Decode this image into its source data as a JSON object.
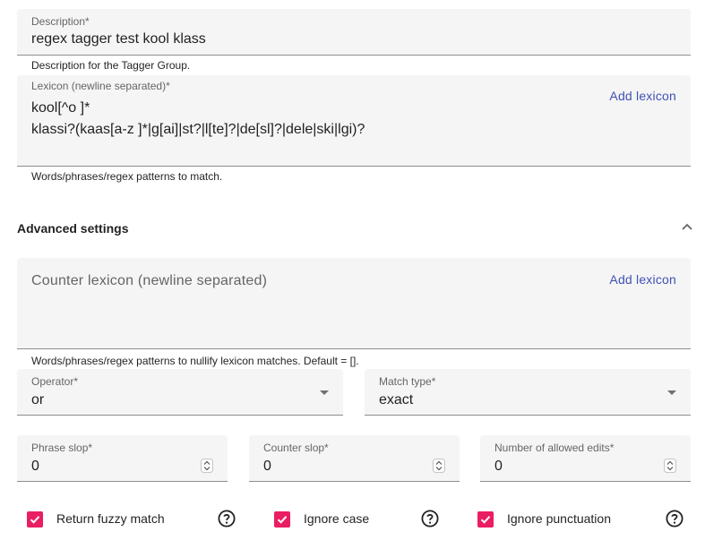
{
  "description": {
    "label": "Description*",
    "value": "regex tagger test kool klass",
    "hint": "Description for the Tagger Group."
  },
  "lexicon": {
    "label": "Lexicon (newline separated)*",
    "lines": [
      "kool[^o ]*",
      "klassi?(kaas[a-z ]*|g[ai]|st?|l[te]?|de[sl]?|dele|ski|lgi)?"
    ],
    "add_label": "Add lexicon",
    "hint": "Words/phrases/regex patterns to match."
  },
  "advanced": {
    "title": "Advanced settings",
    "collapse_icon": "chevron-up-icon"
  },
  "counter_lexicon": {
    "placeholder": "Counter lexicon (newline separated)",
    "add_label": "Add lexicon",
    "hint": "Words/phrases/regex patterns to nullify lexicon matches. Default = []."
  },
  "operator": {
    "label": "Operator*",
    "value": "or"
  },
  "match_type": {
    "label": "Match type*",
    "value": "exact"
  },
  "phrase_slop": {
    "label": "Phrase slop*",
    "value": "0"
  },
  "counter_slop": {
    "label": "Counter slop*",
    "value": "0"
  },
  "allowed_edits": {
    "label": "Number of allowed edits*",
    "value": "0"
  },
  "checkboxes": [
    {
      "label": "Return fuzzy match",
      "checked": true
    },
    {
      "label": "Ignore case",
      "checked": true
    },
    {
      "label": "Ignore punctuation",
      "checked": true
    }
  ],
  "colors": {
    "accent": "#e91e63",
    "link": "#3f51b5",
    "field_bg": "#f5f5f5"
  }
}
